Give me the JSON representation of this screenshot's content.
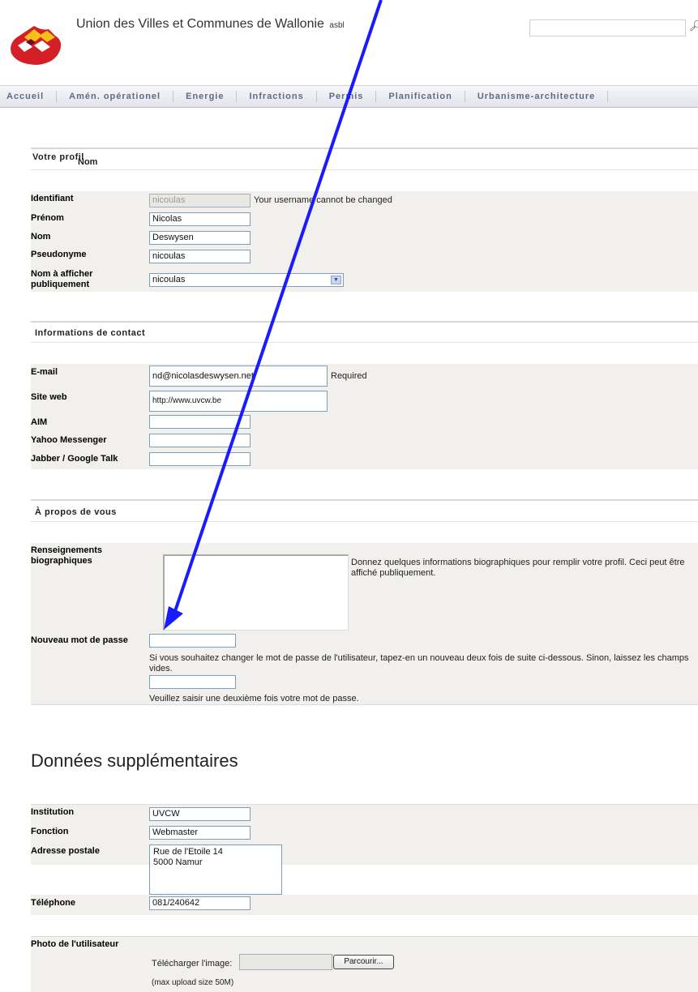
{
  "header": {
    "site_title": "Union des Villes et Communes de Wallonie",
    "site_suffix": "asbl",
    "search_placeholder": ""
  },
  "nav": [
    "Accueil",
    "Amén. opérationel",
    "Energie",
    "Infractions",
    "Permis",
    "Planification",
    "Urbanisme-architecture"
  ],
  "profile": {
    "section_title": "Votre profil",
    "section_sub": "Nom",
    "username_label": "Identifiant",
    "username_value": "nicoulas",
    "username_note": "Your username cannot be changed",
    "firstname_label": "Prénom",
    "firstname_value": "Nicolas",
    "lastname_label": "Nom",
    "lastname_value": "Deswysen",
    "nickname_label": "Pseudonyme",
    "nickname_value": "nicoulas",
    "display_label": "Nom à afficher publiquement",
    "display_value": "nicoulas"
  },
  "contact": {
    "section_title": "Informations de contact",
    "email_label": "E-mail",
    "email_value": "nd@nicolasdeswysen.net",
    "email_note": "Required",
    "website_label": "Site web",
    "website_value": "http://www.uvcw.be",
    "aim_label": "AIM",
    "aim_value": "",
    "yahoo_label": "Yahoo Messenger",
    "yahoo_value": "",
    "jabber_label": "Jabber / Google Talk",
    "jabber_value": ""
  },
  "about": {
    "section_title": "À propos de vous",
    "bio_label": "Renseignements biographiques",
    "bio_value": "",
    "bio_note": "Donnez quelques informations biographiques pour remplir votre profil. Ceci peut être affiché publiquement.",
    "password_label": "Nouveau mot de passe",
    "password_note1": "Si vous souhaitez changer le mot de passe de l'utilisateur, tapez-en un nouveau deux fois de suite ci-dessous. Sinon, laissez les champs vides.",
    "password_note2": "Veuillez saisir une deuxième fois votre mot de passe."
  },
  "extra": {
    "title": "Données supplémentaires",
    "institution_label": "Institution",
    "institution_value": "UVCW",
    "function_label": "Fonction",
    "function_value": "Webmaster",
    "address_label": "Adresse postale",
    "address_value": "Rue de l'Etoile 14\n5000 Namur",
    "phone_label": "Téléphone",
    "phone_value": "081/240642",
    "photo_label": "Photo de l'utilisateur",
    "upload_label": "Télécharger l'image:",
    "browse_label": "Parcourir...",
    "upload_note": "(max upload size 50M)"
  },
  "colors": {
    "annotation_arrow": "#1a1aff",
    "nav_text": "#5d6b86",
    "row_band": "#f1f0ec"
  }
}
